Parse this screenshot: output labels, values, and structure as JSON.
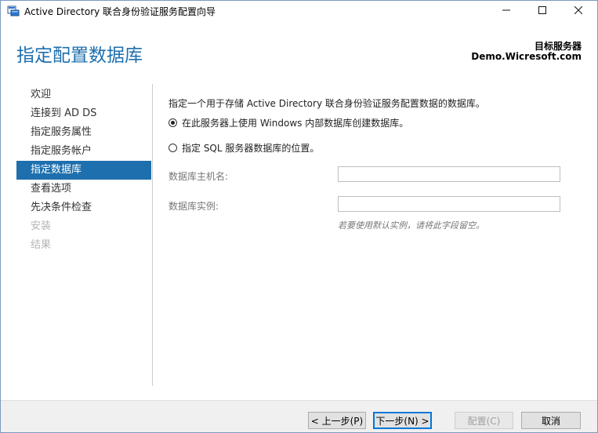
{
  "window": {
    "title": "Active Directory 联合身份验证服务配置向导",
    "minimize_glyph": "—",
    "maximize_glyph": "☐",
    "close_glyph": "✕"
  },
  "header": {
    "page_title": "指定配置数据库",
    "target_label": "目标服务器",
    "target_server": "Demo.Wicresoft.com"
  },
  "sidebar": {
    "items": [
      {
        "label": "欢迎",
        "state": "normal"
      },
      {
        "label": "连接到 AD DS",
        "state": "normal"
      },
      {
        "label": "指定服务属性",
        "state": "normal"
      },
      {
        "label": "指定服务帐户",
        "state": "normal"
      },
      {
        "label": "指定数据库",
        "state": "active"
      },
      {
        "label": "查看选项",
        "state": "normal"
      },
      {
        "label": "先决条件检查",
        "state": "normal"
      },
      {
        "label": "安装",
        "state": "disabled"
      },
      {
        "label": "结果",
        "state": "disabled"
      }
    ]
  },
  "main": {
    "intro": "指定一个用于存储 Active Directory 联合身份验证服务配置数据的数据库。",
    "option_wid": "在此服务器上使用 Windows 内部数据库创建数据库。",
    "option_sql": "指定 SQL 服务器数据库的位置。",
    "selected_option": "option_wid",
    "host_label": "数据库主机名:",
    "host_value": "",
    "instance_label": "数据库实例:",
    "instance_value": "",
    "instance_hint": "若要使用默认实例，请将此字段留空。"
  },
  "footer": {
    "prev_label": "< 上一步(P)",
    "next_label": "下一步(N) >",
    "config_label": "配置(C)",
    "cancel_label": "取消"
  },
  "colors": {
    "accent": "#1e6fae",
    "active_nav_bg": "#1e6fae",
    "disabled_text": "#b5b5b5"
  }
}
